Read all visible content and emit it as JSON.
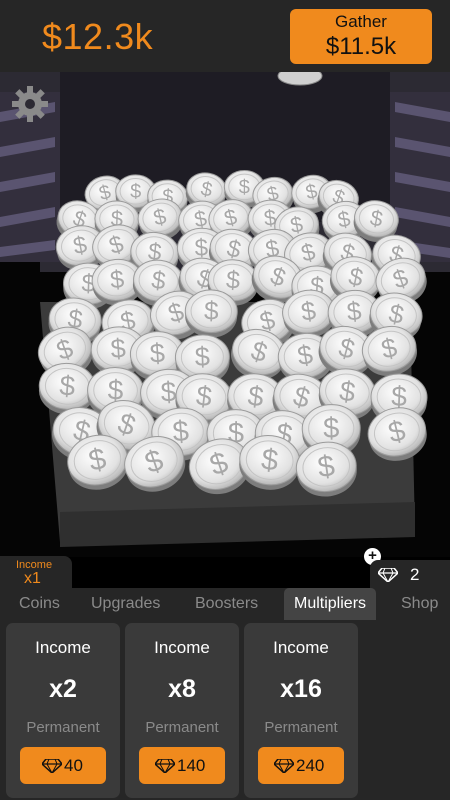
{
  "header": {
    "balance": "$12.3k",
    "gather_label": "Gather",
    "gather_value": "$11.5k"
  },
  "scene": {
    "settings_icon": "gear-icon"
  },
  "status": {
    "income_label": "Income",
    "income_value": "x1",
    "gem_count": "2",
    "plus_symbol": "+"
  },
  "tabs": [
    {
      "label": "Coins"
    },
    {
      "label": "Upgrades"
    },
    {
      "label": "Boosters"
    },
    {
      "label": "Multipliers",
      "active": true
    },
    {
      "label": "Shop"
    }
  ],
  "cards": [
    {
      "title": "Income",
      "multiplier": "x2",
      "subtitle": "Permanent",
      "price": "40"
    },
    {
      "title": "Income",
      "multiplier": "x8",
      "subtitle": "Permanent",
      "price": "140"
    },
    {
      "title": "Income",
      "multiplier": "x16",
      "subtitle": "Permanent",
      "price": "240"
    }
  ],
  "colors": {
    "accent": "#f08a1d",
    "panel": "#262626",
    "card": "#3a3a3a",
    "coin": "#e8e8e8"
  }
}
